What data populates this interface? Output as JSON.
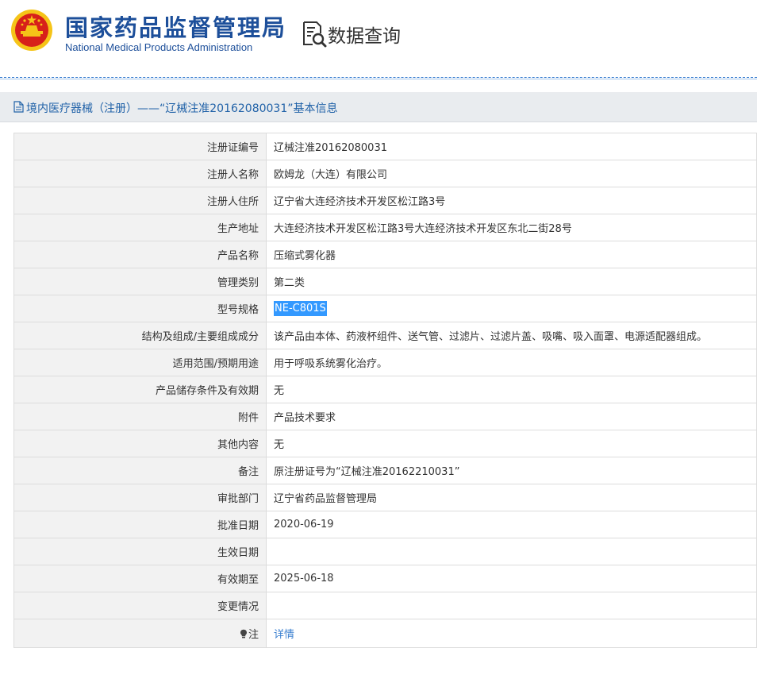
{
  "header": {
    "brand_cn": "国家药品监督管理局",
    "brand_en": "National Medical Products Administration",
    "query_label": "数据查询"
  },
  "panel": {
    "title": "境内医疗器械（注册）——“辽械注准20162080031”基本信息"
  },
  "rows": [
    {
      "label": "注册证编号",
      "value": "辽械注准20162080031"
    },
    {
      "label": "注册人名称",
      "value": "欧姆龙（大连）有限公司"
    },
    {
      "label": "注册人住所",
      "value": "辽宁省大连经济技术开发区松江路3号"
    },
    {
      "label": "生产地址",
      "value": "大连经济技术开发区松江路3号大连经济技术开发区东北二街28号"
    },
    {
      "label": "产品名称",
      "value": "压缩式雾化器"
    },
    {
      "label": "管理类别",
      "value": "第二类"
    },
    {
      "label": "型号规格",
      "value": "NE-C801S"
    },
    {
      "label": "结构及组成/主要组成成分",
      "value": "该产品由本体、药液杯组件、送气管、过滤片、过滤片盖、吸嘴、吸入面罩、电源适配器组成。"
    },
    {
      "label": "适用范围/预期用途",
      "value": "用于呼吸系统雾化治疗。"
    },
    {
      "label": "产品储存条件及有效期",
      "value": "无"
    },
    {
      "label": "附件",
      "value": "产品技术要求"
    },
    {
      "label": "其他内容",
      "value": "无"
    },
    {
      "label": "备注",
      "value": "原注册证号为“辽械注准20162210031”"
    },
    {
      "label": "审批部门",
      "value": "辽宁省药品监督管理局"
    },
    {
      "label": "批准日期",
      "value": "2020-06-19"
    },
    {
      "label": "生效日期",
      "value": ""
    },
    {
      "label": "有效期至",
      "value": "2025-06-18"
    },
    {
      "label": "变更情况",
      "value": ""
    },
    {
      "label": "注",
      "value": "详情"
    }
  ],
  "colors": {
    "brand_blue": "#1d4f9a",
    "link_blue": "#3a7fd0",
    "selection": "#3399ff",
    "emblem_red": "#d7201a",
    "emblem_gold": "#f5c418"
  },
  "icons": {
    "emblem": "national-emblem-icon",
    "query": "data-query-icon",
    "panel": "document-icon",
    "note": "lightbulb-icon"
  }
}
